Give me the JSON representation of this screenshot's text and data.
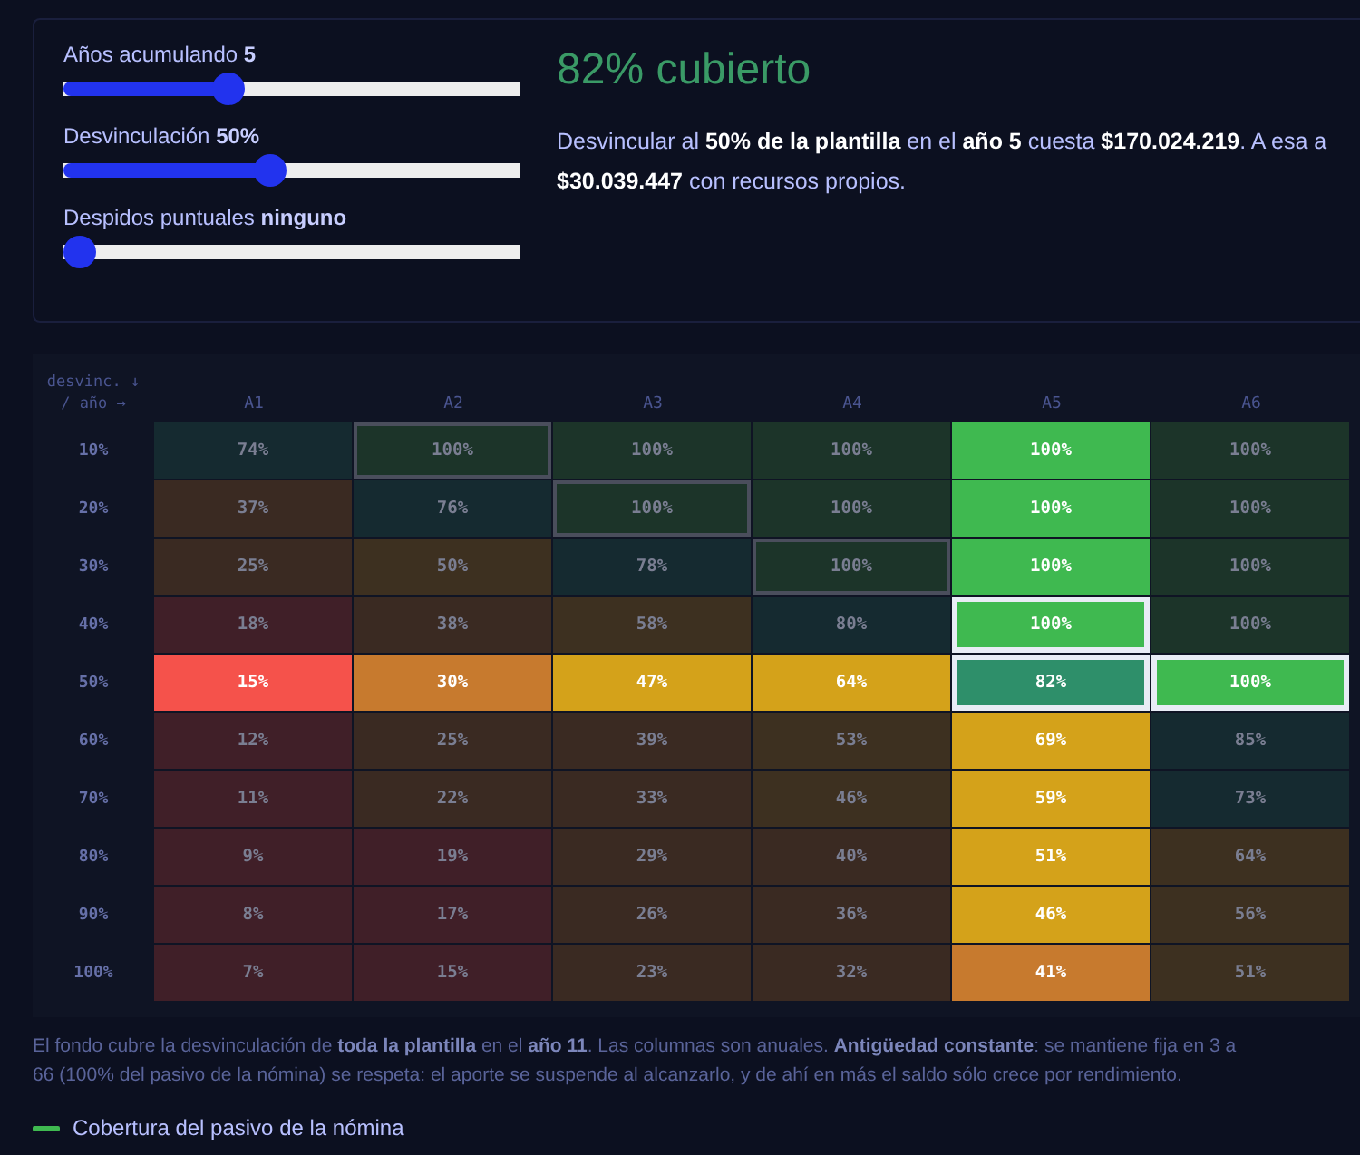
{
  "controls": [
    {
      "label": "Años acumulando",
      "value": "5",
      "level": 0.35
    },
    {
      "label": "Desvinculación",
      "value": "50%",
      "level": 0.45
    },
    {
      "label": "Despidos puntuales",
      "value": "ninguno",
      "level": 0
    }
  ],
  "headline": "82% cubierto",
  "summary": {
    "lines": [
      "Desvincular al **50% de la plantilla** en el **año 5** cuesta **$170.024.219**. A esa a",
      "**$30.039.447** con recursos propios."
    ]
  },
  "table": {
    "corner": "desvinc. ↓ / año →",
    "columns": [
      "A1",
      "A2",
      "A3",
      "A4",
      "A5",
      "A6"
    ],
    "rows": [
      {
        "label": "10%",
        "cells": [
          {
            "text": "74%",
            "color": "#152a30",
            "bright": false,
            "goal": false,
            "focus": false
          },
          {
            "text": "100%",
            "color": "#1c3429",
            "bright": false,
            "goal": true,
            "focus": false
          },
          {
            "text": "100%",
            "color": "#1c3429",
            "bright": false,
            "goal": false,
            "focus": false
          },
          {
            "text": "100%",
            "color": "#1c3429",
            "bright": false,
            "goal": false,
            "focus": false
          },
          {
            "text": "100%",
            "color": "#3fb950",
            "bright": true,
            "goal": false,
            "focus": false
          },
          {
            "text": "100%",
            "color": "#1c3429",
            "bright": false,
            "goal": false,
            "focus": false
          }
        ]
      },
      {
        "label": "20%",
        "cells": [
          {
            "text": "37%",
            "color": "#3a2a22",
            "bright": false,
            "goal": false,
            "focus": false
          },
          {
            "text": "76%",
            "color": "#152a30",
            "bright": false,
            "goal": false,
            "focus": false
          },
          {
            "text": "100%",
            "color": "#1c3429",
            "bright": false,
            "goal": true,
            "focus": false
          },
          {
            "text": "100%",
            "color": "#1c3429",
            "bright": false,
            "goal": false,
            "focus": false
          },
          {
            "text": "100%",
            "color": "#3fb950",
            "bright": true,
            "goal": false,
            "focus": false
          },
          {
            "text": "100%",
            "color": "#1c3429",
            "bright": false,
            "goal": false,
            "focus": false
          }
        ]
      },
      {
        "label": "30%",
        "cells": [
          {
            "text": "25%",
            "color": "#3a2a22",
            "bright": false,
            "goal": false,
            "focus": false
          },
          {
            "text": "50%",
            "color": "#3d3020",
            "bright": false,
            "goal": false,
            "focus": false
          },
          {
            "text": "78%",
            "color": "#152a30",
            "bright": false,
            "goal": false,
            "focus": false
          },
          {
            "text": "100%",
            "color": "#1c3429",
            "bright": false,
            "goal": true,
            "focus": false
          },
          {
            "text": "100%",
            "color": "#3fb950",
            "bright": true,
            "goal": false,
            "focus": false
          },
          {
            "text": "100%",
            "color": "#1c3429",
            "bright": false,
            "goal": false,
            "focus": false
          }
        ]
      },
      {
        "label": "40%",
        "cells": [
          {
            "text": "18%",
            "color": "#401f28",
            "bright": false,
            "goal": false,
            "focus": false
          },
          {
            "text": "38%",
            "color": "#3a2a22",
            "bright": false,
            "goal": false,
            "focus": false
          },
          {
            "text": "58%",
            "color": "#3d3020",
            "bright": false,
            "goal": false,
            "focus": false
          },
          {
            "text": "80%",
            "color": "#152a30",
            "bright": false,
            "goal": false,
            "focus": false
          },
          {
            "text": "100%",
            "color": "#3fb950",
            "bright": true,
            "goal": false,
            "focus": true
          },
          {
            "text": "100%",
            "color": "#1c3429",
            "bright": false,
            "goal": false,
            "focus": false
          }
        ]
      },
      {
        "label": "50%",
        "cells": [
          {
            "text": "15%",
            "color": "#f5524b",
            "bright": true,
            "goal": false,
            "focus": false
          },
          {
            "text": "30%",
            "color": "#c77a2e",
            "bright": true,
            "goal": false,
            "focus": false
          },
          {
            "text": "47%",
            "color": "#d4a21a",
            "bright": true,
            "goal": false,
            "focus": false
          },
          {
            "text": "64%",
            "color": "#d4a21a",
            "bright": true,
            "goal": false,
            "focus": false
          },
          {
            "text": "82%",
            "color": "#2e8f6a",
            "bright": true,
            "goal": false,
            "focus": true
          },
          {
            "text": "100%",
            "color": "#3fb950",
            "bright": true,
            "goal": false,
            "focus": true
          }
        ]
      },
      {
        "label": "60%",
        "cells": [
          {
            "text": "12%",
            "color": "#401f28",
            "bright": false,
            "goal": false,
            "focus": false
          },
          {
            "text": "25%",
            "color": "#3a2a22",
            "bright": false,
            "goal": false,
            "focus": false
          },
          {
            "text": "39%",
            "color": "#3a2a22",
            "bright": false,
            "goal": false,
            "focus": false
          },
          {
            "text": "53%",
            "color": "#3d3020",
            "bright": false,
            "goal": false,
            "focus": false
          },
          {
            "text": "69%",
            "color": "#d4a21a",
            "bright": true,
            "goal": false,
            "focus": false
          },
          {
            "text": "85%",
            "color": "#152a30",
            "bright": false,
            "goal": false,
            "focus": false
          }
        ]
      },
      {
        "label": "70%",
        "cells": [
          {
            "text": "11%",
            "color": "#401f28",
            "bright": false,
            "goal": false,
            "focus": false
          },
          {
            "text": "22%",
            "color": "#3a2a22",
            "bright": false,
            "goal": false,
            "focus": false
          },
          {
            "text": "33%",
            "color": "#3a2a22",
            "bright": false,
            "goal": false,
            "focus": false
          },
          {
            "text": "46%",
            "color": "#3d3020",
            "bright": false,
            "goal": false,
            "focus": false
          },
          {
            "text": "59%",
            "color": "#d4a21a",
            "bright": true,
            "goal": false,
            "focus": false
          },
          {
            "text": "73%",
            "color": "#152a30",
            "bright": false,
            "goal": false,
            "focus": false
          }
        ]
      },
      {
        "label": "80%",
        "cells": [
          {
            "text": "9%",
            "color": "#401f28",
            "bright": false,
            "goal": false,
            "focus": false
          },
          {
            "text": "19%",
            "color": "#401f28",
            "bright": false,
            "goal": false,
            "focus": false
          },
          {
            "text": "29%",
            "color": "#3a2a22",
            "bright": false,
            "goal": false,
            "focus": false
          },
          {
            "text": "40%",
            "color": "#3a2a22",
            "bright": false,
            "goal": false,
            "focus": false
          },
          {
            "text": "51%",
            "color": "#d4a21a",
            "bright": true,
            "goal": false,
            "focus": false
          },
          {
            "text": "64%",
            "color": "#3d3020",
            "bright": false,
            "goal": false,
            "focus": false
          }
        ]
      },
      {
        "label": "90%",
        "cells": [
          {
            "text": "8%",
            "color": "#401f28",
            "bright": false,
            "goal": false,
            "focus": false
          },
          {
            "text": "17%",
            "color": "#401f28",
            "bright": false,
            "goal": false,
            "focus": false
          },
          {
            "text": "26%",
            "color": "#3a2a22",
            "bright": false,
            "goal": false,
            "focus": false
          },
          {
            "text": "36%",
            "color": "#3a2a22",
            "bright": false,
            "goal": false,
            "focus": false
          },
          {
            "text": "46%",
            "color": "#d4a21a",
            "bright": true,
            "goal": false,
            "focus": false
          },
          {
            "text": "56%",
            "color": "#3d3020",
            "bright": false,
            "goal": false,
            "focus": false
          }
        ]
      },
      {
        "label": "100%",
        "cells": [
          {
            "text": "7%",
            "color": "#401f28",
            "bright": false,
            "goal": false,
            "focus": false
          },
          {
            "text": "15%",
            "color": "#401f28",
            "bright": false,
            "goal": false,
            "focus": false
          },
          {
            "text": "23%",
            "color": "#3a2a22",
            "bright": false,
            "goal": false,
            "focus": false
          },
          {
            "text": "32%",
            "color": "#3a2a22",
            "bright": false,
            "goal": false,
            "focus": false
          },
          {
            "text": "41%",
            "color": "#c77a2e",
            "bright": true,
            "goal": false,
            "focus": false
          },
          {
            "text": "51%",
            "color": "#3d3020",
            "bright": false,
            "goal": false,
            "focus": false
          }
        ]
      }
    ]
  },
  "note": {
    "lines": [
      "El fondo cubre la desvinculación de **toda la plantilla** en el **año 11**. Las columnas son anuales. **Antigüedad constante**: se mantiene fija en 3 a",
      "66 (100% del pasivo de la nómina) se respeta: el aporte se suspende al alcanzarlo, y de ahí en más el saldo sólo crece por rendimiento."
    ]
  },
  "legend": {
    "label": "Cobertura del pasivo de la nómina"
  }
}
